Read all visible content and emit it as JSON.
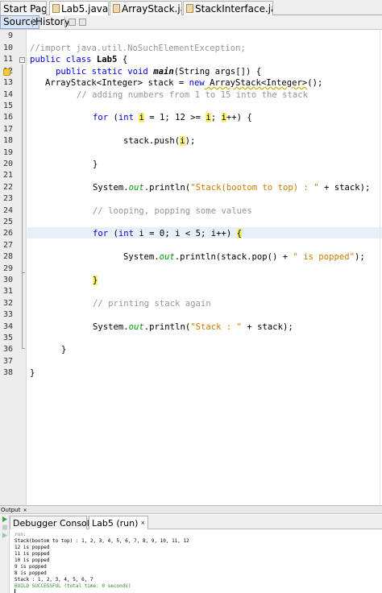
{
  "tabs": [
    {
      "label": "Start Page",
      "file": false,
      "active": false
    },
    {
      "label": "Lab5.java",
      "file": true,
      "active": true
    },
    {
      "label": "ArrayStack.java",
      "file": true,
      "active": false
    },
    {
      "label": "StackInterface.java",
      "file": true,
      "active": false
    }
  ],
  "close_glyph": "×",
  "view": {
    "source": "Source",
    "history": "History"
  },
  "lines": {
    "l10": "//import java.util.NoSuchElementException;",
    "l11a": "public class ",
    "l11b": "Lab5",
    "l11c": " {",
    "l12a": "public static void ",
    "l12b": "main",
    "l12c": "(String args[]) {",
    "l13a": "ArrayStack<Integer> stack = ",
    "l13b": "new",
    "l13c": " ArrayStack<Integer>",
    "l13d": "();",
    "l14": "// adding numbers from 1 to 15 into the stack",
    "l16a": "for",
    "l16b": " (",
    "l16c": "int",
    "l16d": " ",
    "l16e": "i",
    "l16f": " = 1; 12 >= ",
    "l16g": "i",
    "l16h": "; ",
    "l16i": "i",
    "l16j": "++) {",
    "l18a": "stack.push(",
    "l18b": "i",
    "l18c": ");",
    "l20": "}",
    "l22a": "System.",
    "l22b": "out",
    "l22c": ".println(",
    "l22d": "\"Stack(bootom to top) : \"",
    "l22e": " + stack);",
    "l24": "// looping, popping some values",
    "l26a": "for",
    "l26b": " (",
    "l26c": "int",
    "l26d": " i = 0; i < 5; i++) ",
    "l26e": "{",
    "l28a": "System.",
    "l28b": "out",
    "l28c": ".println(stack.pop() + ",
    "l28d": "\" is popped\"",
    "l28e": ");",
    "l30": "}",
    "l32": "// printing stack again",
    "l34a": "System.",
    "l34b": "out",
    "l34c": ".println(",
    "l34d": "\"Stack : \"",
    "l34e": " + stack);",
    "l36": "}",
    "l38": "}"
  },
  "line_numbers": [
    "9",
    "10",
    "11",
    "12",
    "13",
    "14",
    "15",
    "16",
    "17",
    "18",
    "19",
    "20",
    "21",
    "22",
    "23",
    "24",
    "25",
    "26",
    "27",
    "28",
    "29",
    "30",
    "31",
    "32",
    "33",
    "34",
    "35",
    "36",
    "37",
    "38"
  ],
  "output": {
    "panel_title": "Output",
    "tabs": [
      "Debugger Console",
      "Lab5 (run)"
    ],
    "lines": [
      "run:",
      "Stack(bootom to top) : 1, 2, 3, 4, 5, 6, 7, 8, 9, 10, 11, 12",
      "12 is popped",
      "11 is popped",
      "10 is popped",
      "9 is popped",
      "8 is popped",
      "Stack : 1, 2, 3, 4, 5, 6, 7",
      "BUILD SUCCESSFUL (total time: 0 seconds)"
    ]
  },
  "colors": {
    "keyword": "#0000e6",
    "comment": "#969696",
    "string": "#ce7b00",
    "field": "#009900",
    "highlight": "#f8f26f",
    "current_line": "#e9eff8",
    "build_success": "#2a8a2a"
  },
  "icons": {
    "file": "java-file-icon",
    "gutter_warning": "hint-bulb-icon",
    "fold": "fold-toggle-icon",
    "run": "run-again-icon",
    "stop": "stop-icon"
  }
}
